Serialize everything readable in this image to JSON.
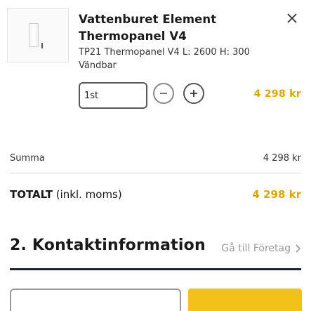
{
  "product": {
    "title": "Vattenburet Element Thermopanel V4",
    "description": "TP21 Thermopanel V4 L: 2600 H: 300",
    "variant": "Vändbar",
    "quantity": "1st",
    "price": "4 298 kr"
  },
  "summary": {
    "subtotal_label": "Summa",
    "subtotal_value": "4 298 kr",
    "total_label_bold": "TOTALT",
    "total_label_rest": " (inkl. moms)",
    "total_value": "4 298 kr"
  },
  "contact": {
    "title": "2. Kontaktinformation",
    "company_link": "Gå till Företag"
  },
  "colors": {
    "accent": "#f2c21a",
    "price": "#d9a800",
    "rule": "#1f2433"
  },
  "icons": [
    "close-icon",
    "minus-icon",
    "plus-icon",
    "chevron-right-icon"
  ]
}
